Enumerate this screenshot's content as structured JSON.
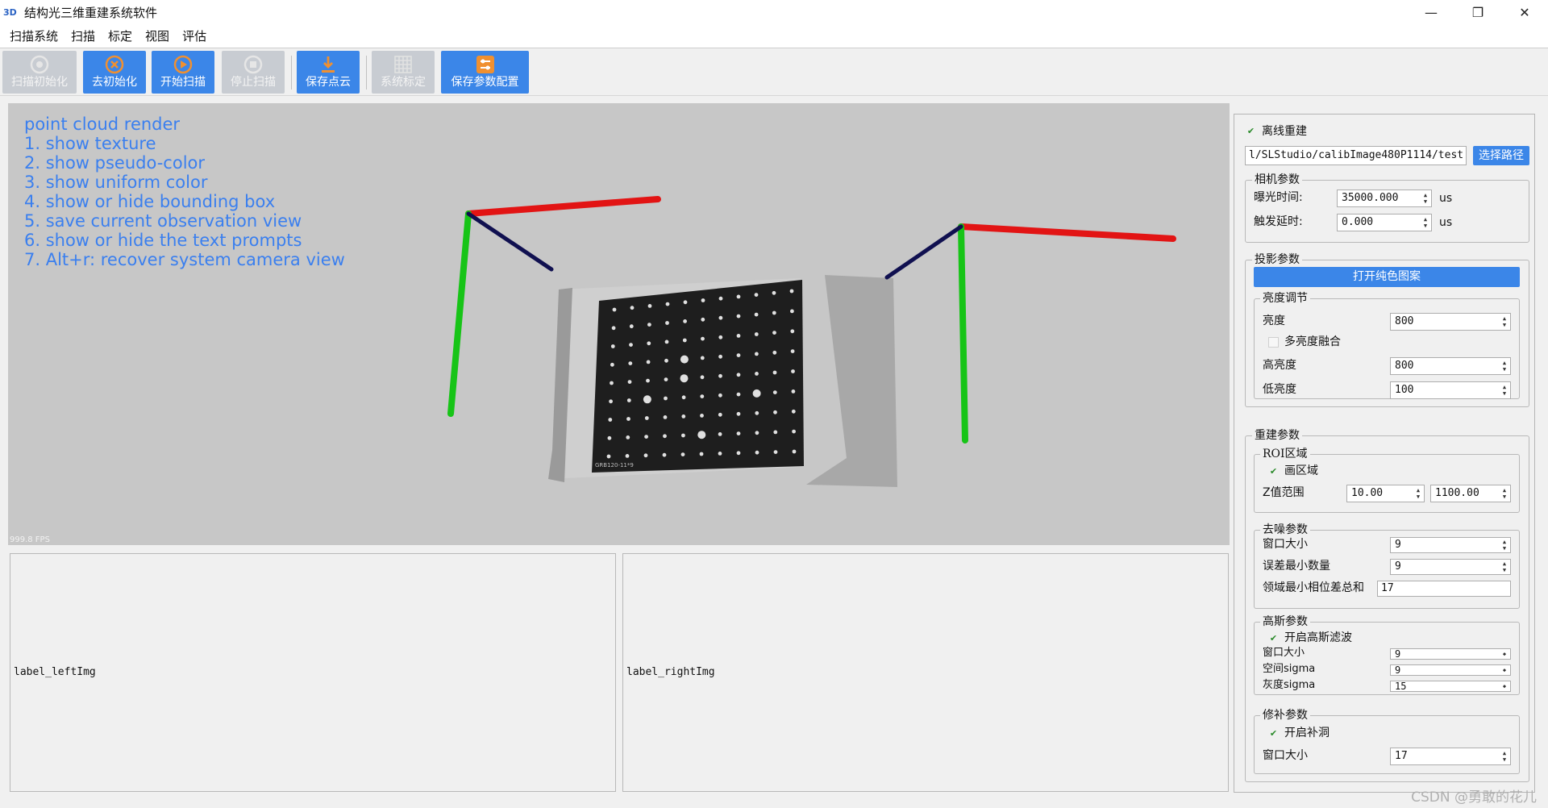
{
  "window": {
    "icon": "3D",
    "title": "结构光三维重建系统软件",
    "controls": [
      "—",
      "❐",
      "✕"
    ]
  },
  "menu": [
    "扫描系统",
    "扫描",
    "标定",
    "视图",
    "评估"
  ],
  "toolbar": {
    "scan_init": "扫描初始化",
    "deinit": "去初始化",
    "start_scan": "开始扫描",
    "stop_scan": "停止扫描",
    "save_cloud": "保存点云",
    "sys_calib": "系统标定",
    "save_config": "保存参数配置"
  },
  "viewer": {
    "prompts": [
      "point cloud render",
      "1. show texture",
      "2. show pseudo-color",
      "3. show uniform color",
      "4. show or hide bounding box",
      "5. save current observation view",
      "6. show or hide the text prompts",
      "7. Alt+r: recover system camera view"
    ],
    "fps": "999.8 FPS",
    "board_label": "GRB120-11*9"
  },
  "panes": {
    "left": "label_leftImg",
    "right": "label_rightImg"
  },
  "panel": {
    "offline": {
      "label": "离线重建",
      "checked": true
    },
    "path": "l/SLStudio/calibImage480P1114/test",
    "choose_path": "选择路径",
    "camera": {
      "title": "相机参数",
      "exposure_label": "曝光时间:",
      "exposure": "35000.000",
      "exposure_unit": "us",
      "delay_label": "触发延时:",
      "delay": "0.000",
      "delay_unit": "us"
    },
    "projection": {
      "title": "投影参数",
      "open_pattern": "打开纯色图案",
      "brightness_group": "亮度调节",
      "brightness_label": "亮度",
      "brightness": "800",
      "multi_label": "多亮度融合",
      "multi_checked": false,
      "high_label": "高亮度",
      "high": "800",
      "low_label": "低亮度",
      "low": "100"
    },
    "recon": {
      "title": "重建参数",
      "roi_group": "ROI区域",
      "draw_region": "画区域",
      "draw_checked": true,
      "z_label": "Z值范围",
      "z_min": "10.00",
      "z_max": "1100.00",
      "denoise_group": "去噪参数",
      "win_label": "窗口大小",
      "win": "9",
      "err_label": "误差最小数量",
      "err": "9",
      "phase_label": "领域最小相位差总和",
      "phase": "17",
      "gauss_group": "高斯参数",
      "gauss_enable": "开启高斯滤波",
      "gauss_checked": true,
      "g_win_label": "窗口大小",
      "g_win": "9",
      "g_space_label": "空间sigma",
      "g_space": "9",
      "g_gray_label": "灰度sigma",
      "g_gray": "15",
      "repair_group": "修补参数",
      "repair_enable": "开启补洞",
      "repair_checked": true,
      "r_win_label": "窗口大小",
      "r_win": "17"
    }
  },
  "watermark": "CSDN @勇敢的花儿",
  "colors": {
    "accent": "#3b86e8",
    "prompt_text": "#3a7fef",
    "axis_x": "#e21414",
    "axis_y": "#17c417",
    "axis_z": "#101050"
  }
}
